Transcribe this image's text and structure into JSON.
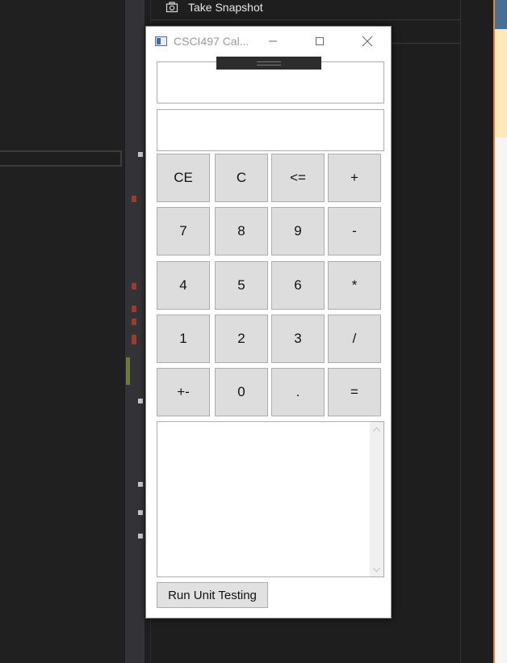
{
  "ide": {
    "snapshot_label": "Take Snapshot"
  },
  "window": {
    "title": "CSCI497 Cal..."
  },
  "calculator": {
    "expression_value": "",
    "result_value": "",
    "keys": [
      {
        "label": "CE",
        "name": "clear-entry-button"
      },
      {
        "label": "C",
        "name": "clear-button"
      },
      {
        "label": "<=",
        "name": "backspace-button"
      },
      {
        "label": "+",
        "name": "add-button"
      },
      {
        "label": "7",
        "name": "digit-7-button"
      },
      {
        "label": "8",
        "name": "digit-8-button"
      },
      {
        "label": "9",
        "name": "digit-9-button"
      },
      {
        "label": "-",
        "name": "subtract-button"
      },
      {
        "label": "4",
        "name": "digit-4-button"
      },
      {
        "label": "5",
        "name": "digit-5-button"
      },
      {
        "label": "6",
        "name": "digit-6-button"
      },
      {
        "label": "*",
        "name": "multiply-button"
      },
      {
        "label": "1",
        "name": "digit-1-button"
      },
      {
        "label": "2",
        "name": "digit-2-button"
      },
      {
        "label": "3",
        "name": "digit-3-button"
      },
      {
        "label": "/",
        "name": "divide-button"
      },
      {
        "label": "+-",
        "name": "negate-button"
      },
      {
        "label": "0",
        "name": "digit-0-button"
      },
      {
        "label": ".",
        "name": "decimal-button"
      },
      {
        "label": "=",
        "name": "equals-button"
      }
    ],
    "output_log": "",
    "run_tests_label": "Run Unit Testing"
  },
  "icons": {
    "snapshot": "camera-icon",
    "minimize": "minimize-icon",
    "maximize": "maximize-icon",
    "close": "close-icon",
    "scroll_up": "chevron-up-icon",
    "scroll_down": "chevron-down-icon"
  },
  "colors": {
    "ide_background": "#1e1e1e",
    "window_background": "#ffffff",
    "key_background": "#dddddd",
    "key_border": "#adadad"
  }
}
